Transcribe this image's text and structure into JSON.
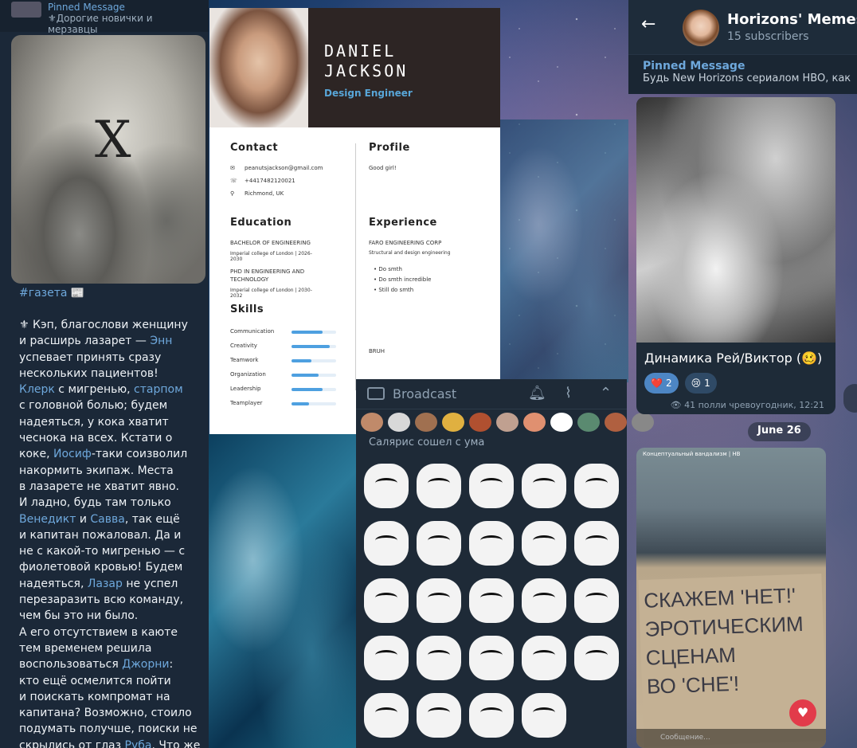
{
  "left_post": {
    "pinned_title": "Pinned Message",
    "pinned_text": "⚜Дорогие новички и мерзавцы",
    "hashtag": "#газета 📰",
    "body_lines": [
      [
        "⚜ Кэп, благослови женщину\nи расширь лазарет — ",
        "Энн",
        "\nуспевает принять сразу\nнескольких пациентов!\n"
      ],
      [
        "",
        "Клерк",
        " с мигренью, "
      ],
      [
        "",
        "старпом",
        "\nс головной болью; будем\nнадеяться, у кока хватит\nчеснока на всех. Кстати о\nкоке, "
      ],
      [
        "",
        "Иосиф",
        "-таки соизволил\nнакормить экипаж. Места\nв лазарете не хватит явно.\nИ ладно, будь там только\n"
      ],
      [
        "",
        "Венедикт",
        " и "
      ],
      [
        "",
        "Савва",
        ", так ещё\nи капитан пожаловал. Да и\nне с какой-то мигренью — с\nфиолетовой кровью! Будем\nнадеяться, "
      ],
      [
        "",
        "Лазар",
        " не успел\nперезаразить всю команду,\nчем бы это ни было.\nА его отсутствием в каюте\nтем временем решила\nвоспользоваться "
      ],
      [
        "",
        "Джорни",
        ":\nкто ещё осмелится пойти\nи поискать компромат на\nкапитана? Возможно, стоило\nподумать получше, поиски не\nскрылись от глаз "
      ],
      [
        "",
        "Руба",
        ". Что же\nон теперь, сдаст юнгу?"
      ]
    ]
  },
  "resume": {
    "name": "DANIEL\nJACKSON",
    "role": "Design Engineer",
    "contact_title": "Contact",
    "email": "peanutsjackson@gmail.com",
    "phone": "+4417482120021",
    "location": "Richmond, UK",
    "profile_title": "Profile",
    "profile_text": "Good girl!",
    "education_title": "Education",
    "edu1": "BACHELOR OF ENGINEERING",
    "edu1_place": "Imperial college of London | 2026-\n2030",
    "edu2": "PHD IN ENGINEERING AND\nTECHNOLOGY",
    "edu2_place": "Imperial college of London | 2030-\n2032",
    "experience_title": "Experience",
    "exp_company": "FARO ENGINEERING CORP",
    "exp_desc": "Structural and design engineering",
    "exp_items": [
      "• Do smth",
      "• Do smth incredible",
      "• Still do smth"
    ],
    "bruh": "BRUH",
    "skills_title": "Skills",
    "skills": [
      {
        "name": "Communication",
        "level": 0.7
      },
      {
        "name": "Creativity",
        "level": 0.85
      },
      {
        "name": "Teamwork",
        "level": 0.45
      },
      {
        "name": "Organization",
        "level": 0.6
      },
      {
        "name": "Leadership",
        "level": 0.7
      },
      {
        "name": "Teamplayer",
        "level": 0.4
      }
    ]
  },
  "broadcast": {
    "input_label": "Broadcast",
    "pack_title": "Салярис сошел с ума",
    "sticker_count": 24
  },
  "channel": {
    "title": "Horizons' Memes",
    "subscribers": "15 subscribers",
    "pinned_title": "Pinned Message",
    "pinned_text": "Будь New Horizons сериалом HBO, как",
    "caption": "Динамика Рей/Виктор (🥴)",
    "reactions": [
      {
        "emoji": "❤️",
        "count": "2"
      },
      {
        "emoji": "😢",
        "count": "1"
      }
    ],
    "views": "41",
    "author_time": "полли чревоугодник, 12:21",
    "date": "June 26",
    "sign_text": "СКАЖЕМ 'НЕТ!'\nЭРОТИЧЕСКИМ\nСЦЕНАМ\nВО 'CHE'!",
    "forward_source": "Концептуальный вандализм | НВ",
    "bottom_bar": "Сообщение..."
  }
}
